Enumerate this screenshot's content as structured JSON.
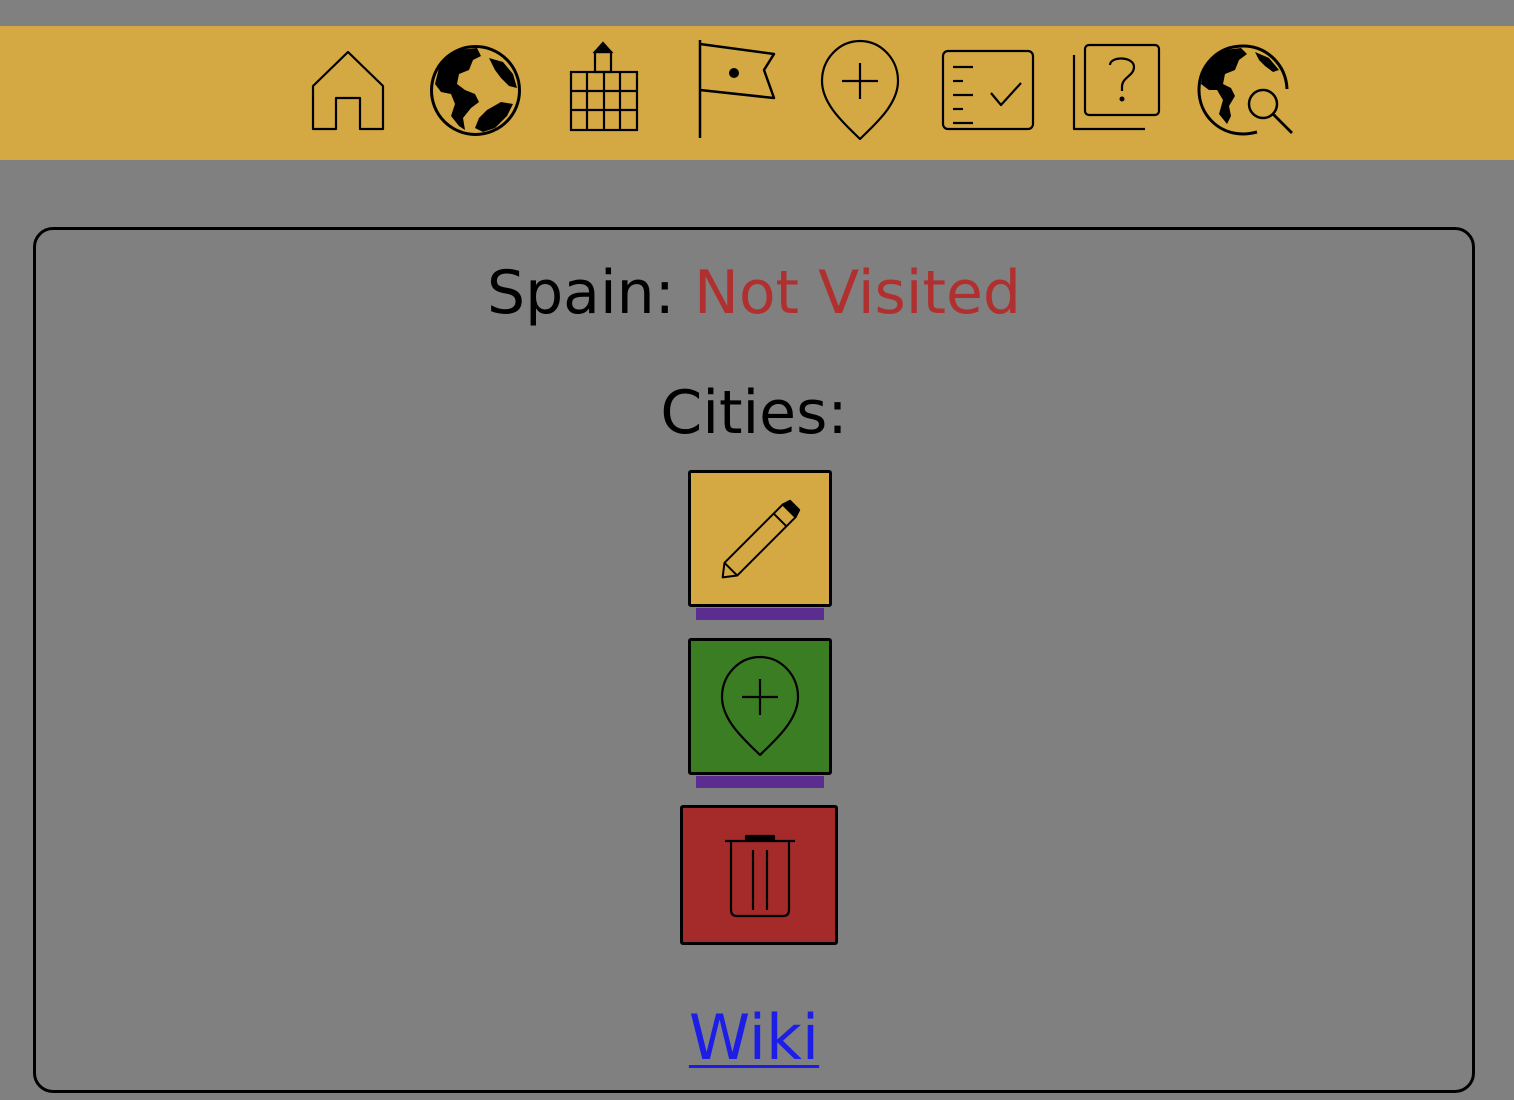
{
  "nav": {
    "items": [
      {
        "icon": "home-icon"
      },
      {
        "icon": "globe-icon"
      },
      {
        "icon": "city-building-icon"
      },
      {
        "icon": "flag-icon"
      },
      {
        "icon": "add-location-pin-icon"
      },
      {
        "icon": "checklist-icon"
      },
      {
        "icon": "quiz-question-icon"
      },
      {
        "icon": "globe-search-icon"
      }
    ]
  },
  "country": {
    "label": "Spain:",
    "status": "Not Visited"
  },
  "cities": {
    "label": "Cities:"
  },
  "actions": {
    "edit": {
      "icon": "pencil-icon"
    },
    "add_city": {
      "icon": "add-location-pin-icon"
    },
    "delete": {
      "icon": "trash-icon"
    }
  },
  "wiki": {
    "label": "Wiki"
  },
  "colors": {
    "page_background": "#808080",
    "navbar": "#d4a843",
    "status_not_visited": "#b03030",
    "edit_button": "#d4a843",
    "add_button": "#3a7d22",
    "delete_button": "#a52a2a",
    "underline_bar": "#5c2d91",
    "link": "#1d1de8"
  }
}
